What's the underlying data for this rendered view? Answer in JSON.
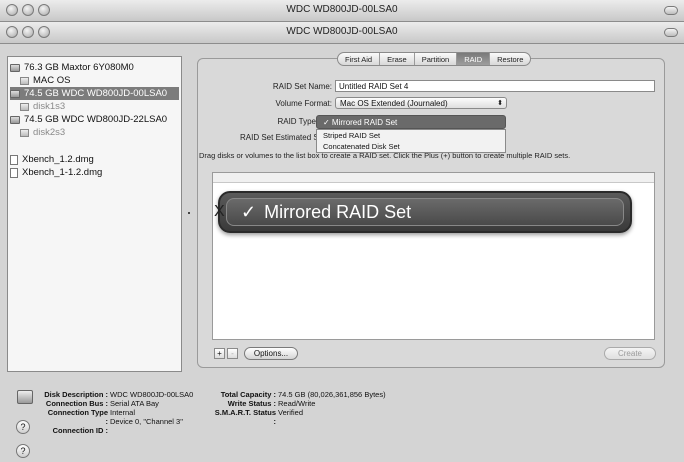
{
  "window": {
    "title_back": "WDC WD800JD-00LSA0",
    "title_front": "WDC WD800JD-00LSA0"
  },
  "sidebar": {
    "items": [
      {
        "label": "76.3 GB Maxtor 6Y080M0",
        "icon": "disk-icon"
      },
      {
        "label": "MAC OS",
        "icon": "volume-icon"
      },
      {
        "label": "74.5 GB WDC WD800JD-00LSA0",
        "icon": "disk-icon"
      },
      {
        "label": "disk1s3",
        "icon": "volume-icon"
      },
      {
        "label": "74.5 GB WDC WD800JD-22LSA0",
        "icon": "disk-icon"
      },
      {
        "label": "disk2s3",
        "icon": "volume-icon"
      },
      {
        "label": "Xbench_1.2.dmg",
        "icon": "dmg-icon"
      },
      {
        "label": "Xbench_1-1.2.dmg",
        "icon": "dmg-icon"
      }
    ]
  },
  "tabs": [
    "First Aid",
    "Erase",
    "Partition",
    "RAID",
    "Restore"
  ],
  "form": {
    "set_name_label": "RAID Set Name:",
    "set_name_value": "Untitled RAID Set 4",
    "volume_format_label": "Volume Format:",
    "volume_format_value": "Mac OS Extended (Journaled)",
    "raid_type_label": "RAID Type",
    "raid_type_value": "✓ Mirrored RAID Set",
    "est_size_label": "RAID Set Estimated Size"
  },
  "raid_menu": [
    "Striped RAID Set",
    "Concatenated Disk Set"
  ],
  "hint_text": "Drag disks or volumes to the list box to create a RAID set. Click the Plus (+) button to create multiple RAID sets.",
  "zoom": {
    "check": "✓",
    "label": "Mirrored RAID Set",
    "edge": "X"
  },
  "buttons": {
    "plus": "+",
    "minus": "-",
    "options": "Options...",
    "create": "Create"
  },
  "info": {
    "left": [
      {
        "key": "Disk Description :",
        "value": "WDC WD800JD-00LSA0"
      },
      {
        "key": "Connection Bus :",
        "value": "Serial ATA Bay"
      },
      {
        "key": "Connection Type :",
        "value": "Internal"
      },
      {
        "key": "Connection ID :",
        "value": "Device 0, \"Channel 3\""
      }
    ],
    "right": [
      {
        "key": "Total Capacity :",
        "value": "74.5 GB (80,026,361,856 Bytes)"
      },
      {
        "key": "Write Status :",
        "value": "Read/Write"
      },
      {
        "key": "S.M.A.R.T. Status :",
        "value": "Verified"
      }
    ]
  },
  "help": "?"
}
